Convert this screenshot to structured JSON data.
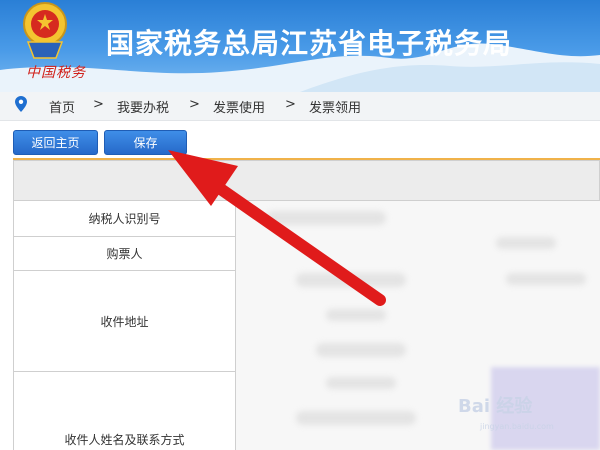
{
  "header": {
    "title": "国家税务总局江苏省电子税务局",
    "brand_script": "中国税务"
  },
  "breadcrumb": {
    "items": [
      "首页",
      "我要办税",
      "发票使用",
      "发票领用"
    ],
    "separator": ">"
  },
  "toolbar": {
    "home_label": "返回主页",
    "save_label": "保存"
  },
  "form": {
    "fields": [
      "纳税人识别号",
      "购票人",
      "收件地址",
      "收件人姓名及联系方式"
    ]
  },
  "watermark": {
    "text": "Bai 经验",
    "subtext": "jingyan.baidu.com"
  },
  "colors": {
    "header_blue": "#2a7fd6",
    "button_blue": "#2f76d6",
    "accent_orange": "#f0b24a",
    "arrow_red": "#e01b1b",
    "emblem_red": "#d0201a"
  }
}
